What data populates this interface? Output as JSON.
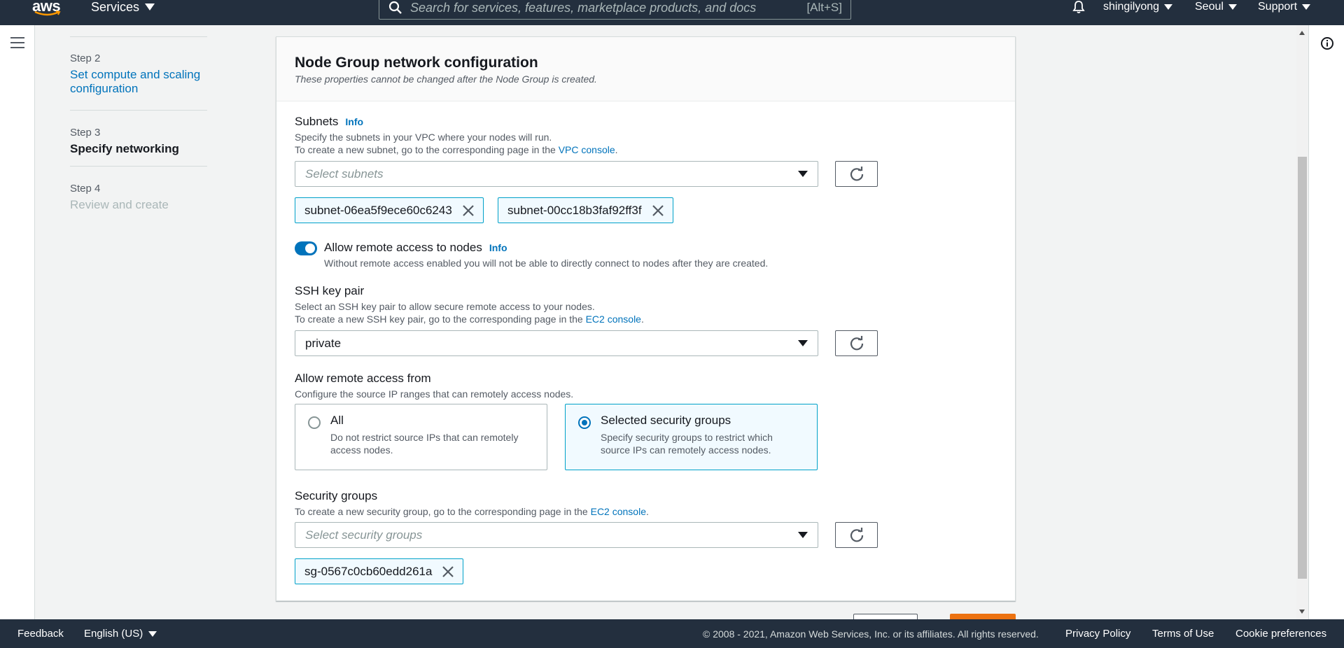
{
  "topnav": {
    "logo_text": "aws",
    "services_label": "Services",
    "search_placeholder": "Search for services, features, marketplace products, and docs",
    "search_shortcut": "[Alt+S]",
    "user": "shingilyong",
    "region": "Seoul",
    "support": "Support"
  },
  "steps": [
    {
      "step": "Step 2",
      "title": "Set compute and scaling configuration",
      "state": "link"
    },
    {
      "step": "Step 3",
      "title": "Specify networking",
      "state": "active"
    },
    {
      "step": "Step 4",
      "title": "Review and create",
      "state": "disabled"
    }
  ],
  "panel": {
    "title": "Node Group network configuration",
    "description": "These properties cannot be changed after the Node Group is created."
  },
  "subnets": {
    "label": "Subnets",
    "info": "Info",
    "desc1": "Specify the subnets in your VPC where your nodes will run.",
    "desc2_prefix": "To create a new subnet, go to the corresponding page in the ",
    "desc2_link": "VPC console",
    "desc2_suffix": ".",
    "placeholder": "Select subnets",
    "tokens": [
      "subnet-06ea5f9ece60c6243",
      "subnet-00cc18b3faf92ff3f"
    ]
  },
  "remote_access": {
    "label": "Allow remote access to nodes",
    "info": "Info",
    "desc": "Without remote access enabled you will not be able to directly connect to nodes after they are created.",
    "enabled": true
  },
  "ssh": {
    "label": "SSH key pair",
    "desc1": "Select an SSH key pair to allow secure remote access to your nodes.",
    "desc2_prefix": "To create a new SSH key pair, go to the corresponding page in the ",
    "desc2_link": "EC2 console",
    "desc2_suffix": ".",
    "value": "private"
  },
  "access_from": {
    "label": "Allow remote access from",
    "desc": "Configure the source IP ranges that can remotely access nodes.",
    "options": [
      {
        "title": "All",
        "desc": "Do not restrict source IPs that can remotely access nodes.",
        "selected": false
      },
      {
        "title": "Selected security groups",
        "desc": "Specify security groups to restrict which source IPs can remotely access nodes.",
        "selected": true
      }
    ]
  },
  "security_groups": {
    "label": "Security groups",
    "desc_prefix": "To create a new security group, go to the corresponding page in the ",
    "desc_link": "EC2 console",
    "desc_suffix": ".",
    "placeholder": "Select security groups",
    "tokens": [
      "sg-0567c0cb60edd261a"
    ]
  },
  "footer": {
    "feedback": "Feedback",
    "language": "English (US)",
    "copyright": "© 2008 - 2021, Amazon Web Services, Inc. or its affiliates. All rights reserved.",
    "privacy": "Privacy Policy",
    "terms": "Terms of Use",
    "cookies": "Cookie preferences"
  },
  "colors": {
    "nav_bg": "#232f3e",
    "link": "#0073bb",
    "primary_button": "#ec7211",
    "token_border": "#00a1c9"
  }
}
